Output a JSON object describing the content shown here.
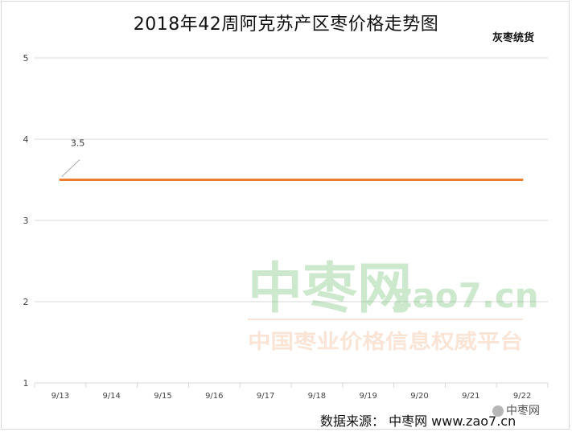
{
  "chart_data": {
    "type": "line",
    "title": "2018年42周阿克苏产区枣价格走势图",
    "categories": [
      "9/13",
      "9/14",
      "9/15",
      "9/16",
      "9/17",
      "9/18",
      "9/19",
      "9/20",
      "9/21",
      "9/22"
    ],
    "series": [
      {
        "name": "灰枣统货",
        "values": [
          3.5,
          3.5,
          3.5,
          3.5,
          3.5,
          3.5,
          3.5,
          3.5,
          3.5,
          3.5
        ],
        "color": "#ed7d31"
      }
    ],
    "data_labels": [
      {
        "index": 0,
        "text": "3.5"
      }
    ],
    "ylim": [
      1,
      5
    ],
    "yticks": [
      "1",
      "2",
      "3",
      "4",
      "5"
    ],
    "grid": true,
    "xlabel": "",
    "ylabel": ""
  },
  "series_tag": "灰枣统货",
  "watermark": {
    "cn": "中枣网",
    "domain": "zao7.cn",
    "slogan": "中国枣业价格信息权威平台"
  },
  "source_line": "数据来源：   中枣网 www.zao7.cn",
  "corner_badge": "中枣网",
  "colors": {
    "line": "#ed7d31",
    "grid": "#d9d9d9",
    "watermark_green": "#4caf50",
    "watermark_orange": "#f0a070"
  }
}
